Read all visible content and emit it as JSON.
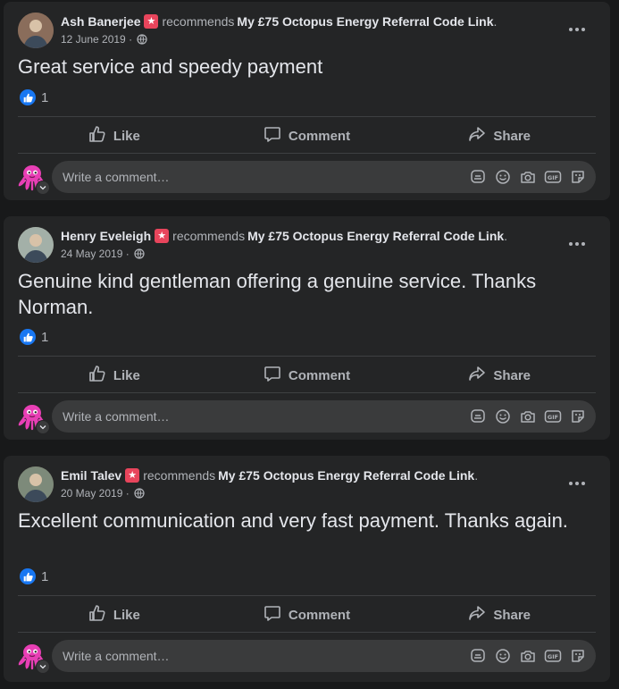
{
  "posts": [
    {
      "author": "Ash Banerjee",
      "recommends_word": "recommends",
      "page": "My £75 Octopus Energy Referral Code Link",
      "date": "12 June 2019",
      "text": "Great service and speedy payment",
      "likes": "1"
    },
    {
      "author": "Henry Eveleigh",
      "recommends_word": "recommends",
      "page": "My £75 Octopus Energy Referral Code Link",
      "date": "24 May 2019",
      "text": "Genuine kind gentleman offering a genuine service. Thanks Norman.",
      "likes": "1"
    },
    {
      "author": "Emil Talev",
      "recommends_word": "recommends",
      "page": "My £75 Octopus Energy Referral Code Link",
      "date": "20 May 2019",
      "text": "Excellent communication and very fast payment. Thanks again.",
      "likes": "1"
    }
  ],
  "actions": {
    "like": "Like",
    "comment": "Comment",
    "share": "Share"
  },
  "comment_placeholder": "Write a comment…",
  "colors": {
    "accent": "#1877f2",
    "badge": "#e8455c",
    "octopus": "#e83fb5"
  }
}
